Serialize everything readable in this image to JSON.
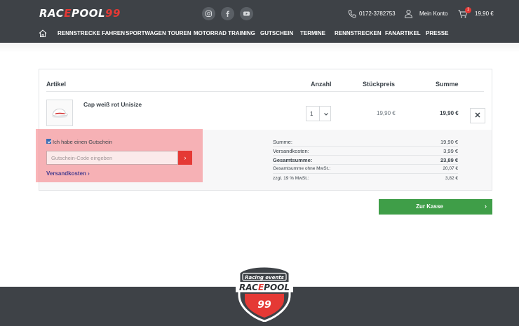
{
  "header": {
    "logo_text_1": "RAC",
    "logo_text_2": "E",
    "logo_text_3": "POOL",
    "logo_text_4": "99",
    "social_icons": [
      "instagram-icon",
      "facebook-icon",
      "youtube-icon"
    ],
    "phone": "0172-3782753",
    "account_label": "Mein Konto",
    "cart_count": "1",
    "cart_total": "19,90 €"
  },
  "nav": {
    "home_icon": "home-icon",
    "items": [
      "RENNSTRECKE FAHREN",
      "SPORTWAGEN TOUREN",
      "MOTORRAD TRAINING",
      "GUTSCHEIN",
      "TERMINE",
      "RENNSTRECKEN",
      "FANARTIKEL",
      "PRESSE"
    ]
  },
  "cart": {
    "headers": {
      "article": "Artikel",
      "quantity": "Anzahl",
      "unit_price": "Stückpreis",
      "total": "Summe"
    },
    "items": [
      {
        "name": "Cap weiß rot Unisize",
        "quantity": "1",
        "unit_price": "19,90 €",
        "total": "19,90 €"
      }
    ],
    "remove_symbol": "✕"
  },
  "voucher": {
    "checkbox_label": "Ich habe einen Gutschein",
    "checked": true,
    "placeholder": "Gutschein-Code eingeben",
    "submit_symbol": "›",
    "shipping_link": "Versandkosten ›"
  },
  "summary": {
    "rows": [
      {
        "label": "Summe:",
        "value": "19,90 €"
      },
      {
        "label": "Versandkosten:",
        "value": "3,99 €"
      },
      {
        "label": "Gesamtsumme:",
        "value": "23,89 €"
      },
      {
        "label": "Gesamtsumme ohne MwSt.:",
        "value": "20,07 €"
      },
      {
        "label": "zzgl. 19 % MwSt.:",
        "value": "3,82 €"
      }
    ]
  },
  "checkout": {
    "label": "Zur Kasse",
    "chevron": "›"
  },
  "footer": {
    "badge_top": "Racing events",
    "badge_main_1": "RAC",
    "badge_main_2": "E",
    "badge_main_3": "POOL",
    "badge_number": "99"
  },
  "colors": {
    "header_bg": "#3e4247",
    "brand_red": "#e53935",
    "checkout_green": "#3f9e48",
    "link_purple": "#4a3f8f"
  }
}
